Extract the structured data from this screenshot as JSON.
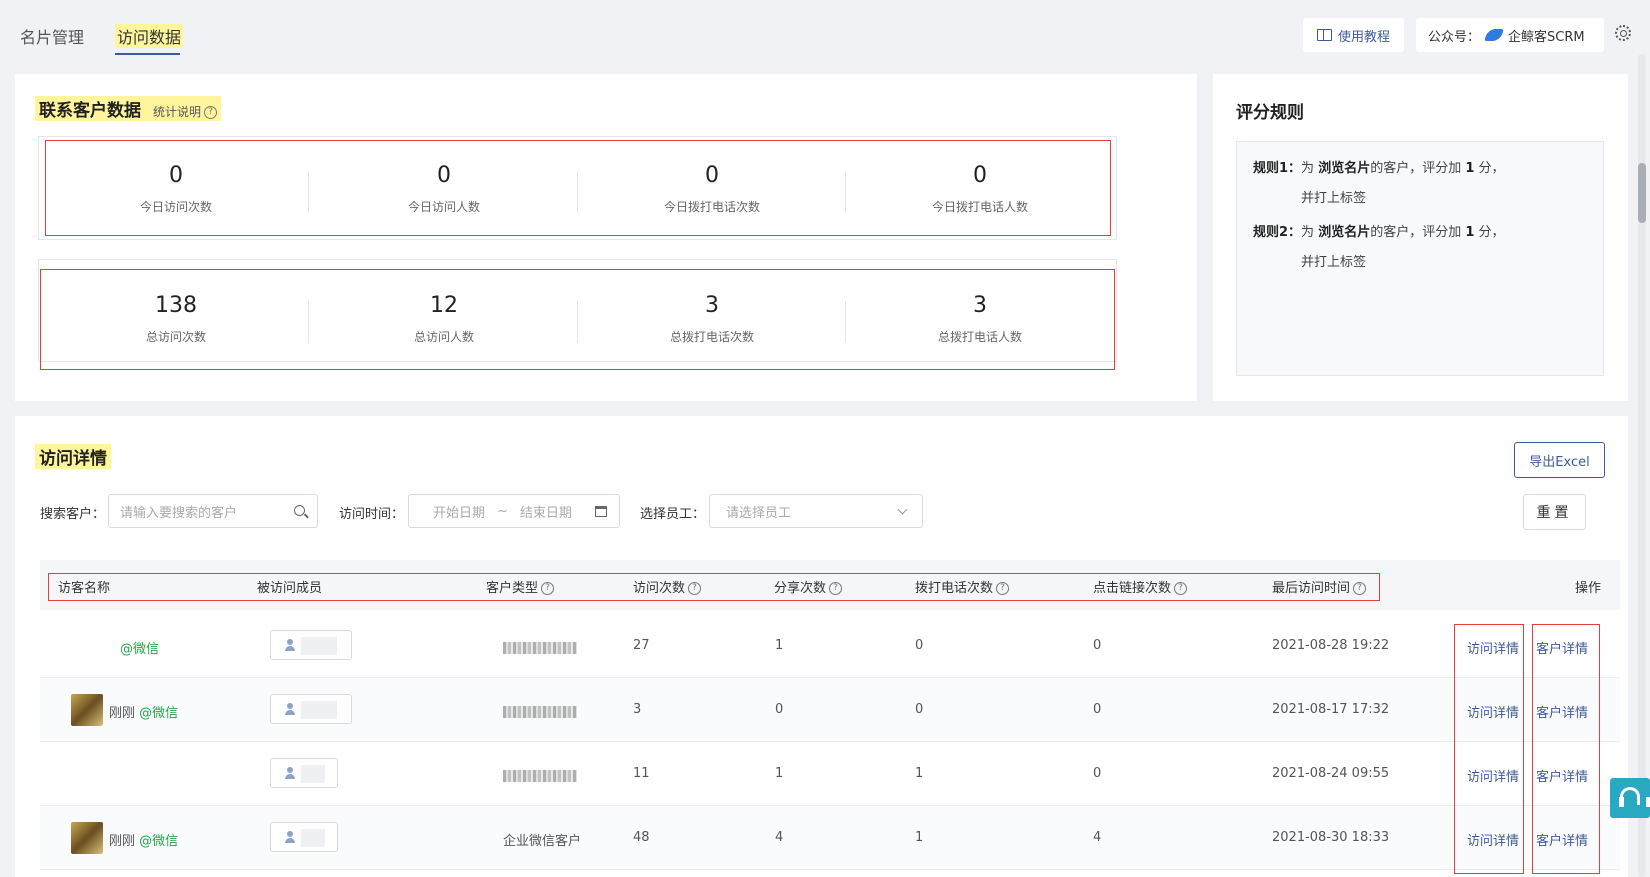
{
  "tabs": [
    "名片管理",
    "访问数据"
  ],
  "header": {
    "help_label": "使用教程",
    "account_prefix": "公众号：",
    "account_name": "企鲸客SCRM"
  },
  "contact_stats": {
    "title": "联系客户数据",
    "hint": "统计说明",
    "today": [
      {
        "value": "0",
        "label": "今日访问次数"
      },
      {
        "value": "0",
        "label": "今日访问人数"
      },
      {
        "value": "0",
        "label": "今日拨打电话次数"
      },
      {
        "value": "0",
        "label": "今日拨打电话人数"
      }
    ],
    "total": [
      {
        "value": "138",
        "label": "总访问次数"
      },
      {
        "value": "12",
        "label": "总访问人数"
      },
      {
        "value": "3",
        "label": "总拨打电话次数"
      },
      {
        "value": "3",
        "label": "总拨打电话人数"
      }
    ]
  },
  "rules": {
    "title": "评分规则",
    "items": [
      {
        "name": "规则1：",
        "pre": "为 ",
        "target": "浏览名片",
        "mid": "的客户，评分加 ",
        "score": "1",
        "post": " 分，",
        "line2": "并打上标签"
      },
      {
        "name": "规则2：",
        "pre": "为 ",
        "target": "浏览名片",
        "mid": "的客户，评分加 ",
        "score": "1",
        "post": " 分，",
        "line2": "并打上标签"
      }
    ]
  },
  "details": {
    "title": "访问详情",
    "export_label": "导出Excel",
    "reset_label": "重置",
    "filters": {
      "search_label": "搜索客户：",
      "search_placeholder": "请输入要搜索的客户",
      "time_label": "访问时间：",
      "start_placeholder": "开始日期",
      "separator": "~",
      "end_placeholder": "结束日期",
      "staff_label": "选择员工：",
      "staff_placeholder": "请选择员工"
    },
    "columns": [
      "访客名称",
      "被访问成员",
      "客户类型",
      "访问次数",
      "分享次数",
      "拨打电话次数",
      "点击链接次数",
      "最后访问时间",
      "操作"
    ],
    "rows": [
      {
        "name": "",
        "source": "@微信",
        "type": "",
        "visits": "27",
        "shares": "1",
        "calls": "0",
        "clicks": "0",
        "last_visit": "2021-08-28 19:22",
        "action1": "访问详情",
        "action2": "客户详情"
      },
      {
        "name": "刚刚",
        "source": "@微信",
        "type": "",
        "visits": "3",
        "shares": "0",
        "calls": "0",
        "clicks": "0",
        "last_visit": "2021-08-17 17:32",
        "action1": "访问详情",
        "action2": "客户详情"
      },
      {
        "name": "",
        "source": "",
        "type": "",
        "visits": "11",
        "shares": "1",
        "calls": "1",
        "clicks": "0",
        "last_visit": "2021-08-24 09:55",
        "action1": "访问详情",
        "action2": "客户详情"
      },
      {
        "name": "刚刚",
        "source": "@微信",
        "type": "企业微信客户",
        "visits": "48",
        "shares": "4",
        "calls": "1",
        "clicks": "4",
        "last_visit": "2021-08-30 18:33",
        "action1": "访问详情",
        "action2": "客户详情"
      }
    ]
  },
  "colors": {
    "accent": "#3d5a9c",
    "highlight": "#fff59d",
    "wechat_green": "#22a84a",
    "annotation_red": "#e04040"
  }
}
